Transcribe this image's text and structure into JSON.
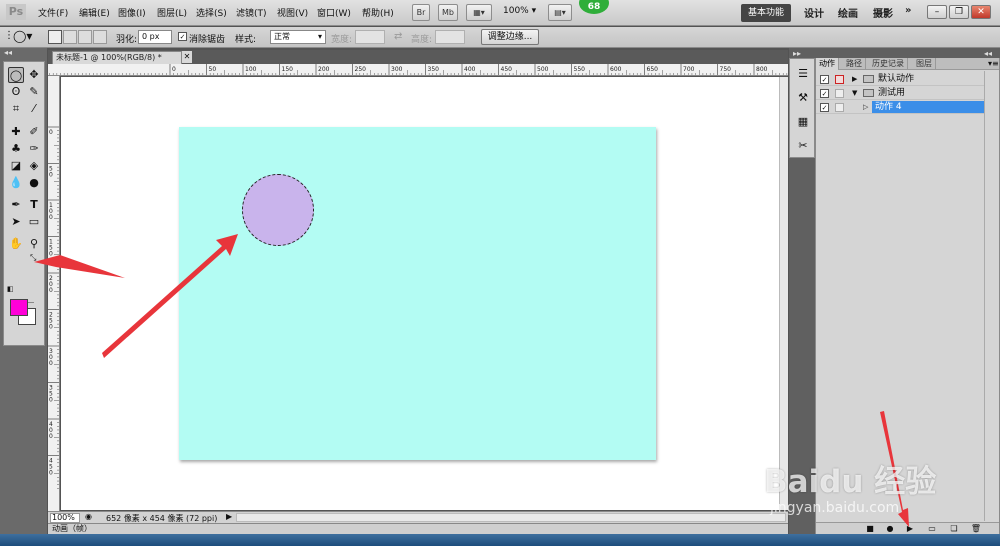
{
  "app": {
    "logo": "Ps"
  },
  "menu": {
    "items": [
      "文件(F)",
      "编辑(E)",
      "图像(I)",
      "图层(L)",
      "选择(S)",
      "滤镜(T)",
      "视图(V)",
      "窗口(W)",
      "帮助(H)"
    ],
    "br_label": "Br",
    "mb_label": "Mb",
    "zoom": "100%",
    "badge": "68"
  },
  "workspaces": {
    "basic": "基本功能",
    "design": "设计",
    "painting": "绘画",
    "photography": "摄影",
    "more": "»"
  },
  "options": {
    "feather_label": "羽化:",
    "feather_value": "0 px",
    "antialias_label": "消除锯齿",
    "style_label": "样式:",
    "style_value": "正常",
    "width_label": "宽度:",
    "height_label": "高度:",
    "refine_edge": "调整边缘..."
  },
  "document": {
    "tab_title": "未标题-1 @ 100%(RGB/8) *",
    "zoom_status": "100%",
    "info": "652 像素 x 454 像素 (72 ppi)",
    "ruler_top_ticks": [
      "0",
      "50",
      "100",
      "150",
      "200",
      "250",
      "300",
      "350",
      "400",
      "450",
      "500",
      "550",
      "600",
      "650",
      "700",
      "750",
      "800"
    ],
    "ruler_left_ticks": [
      "0",
      "50",
      "100",
      "150",
      "200",
      "250",
      "300",
      "350",
      "400",
      "450"
    ]
  },
  "colors": {
    "foreground": "#ff00d8",
    "background": "#ffffff",
    "canvas_fill": "#b3fcf3",
    "selection_fill": "#c9b4ec",
    "arrow": "#e8353b"
  },
  "animation_panel": {
    "label": "动画（帧）"
  },
  "panel": {
    "tabs": [
      "动作",
      "路径",
      "历史记录",
      "图层"
    ],
    "actions": [
      {
        "name": "默认动作",
        "expanded": false,
        "type": "set"
      },
      {
        "name": "测试用",
        "expanded": true,
        "type": "set"
      },
      {
        "name": "动作 4",
        "expanded": false,
        "type": "action",
        "selected": true
      }
    ]
  },
  "watermark": {
    "brand": "Baidu 经验",
    "url": "jingyan.baidu.com"
  }
}
